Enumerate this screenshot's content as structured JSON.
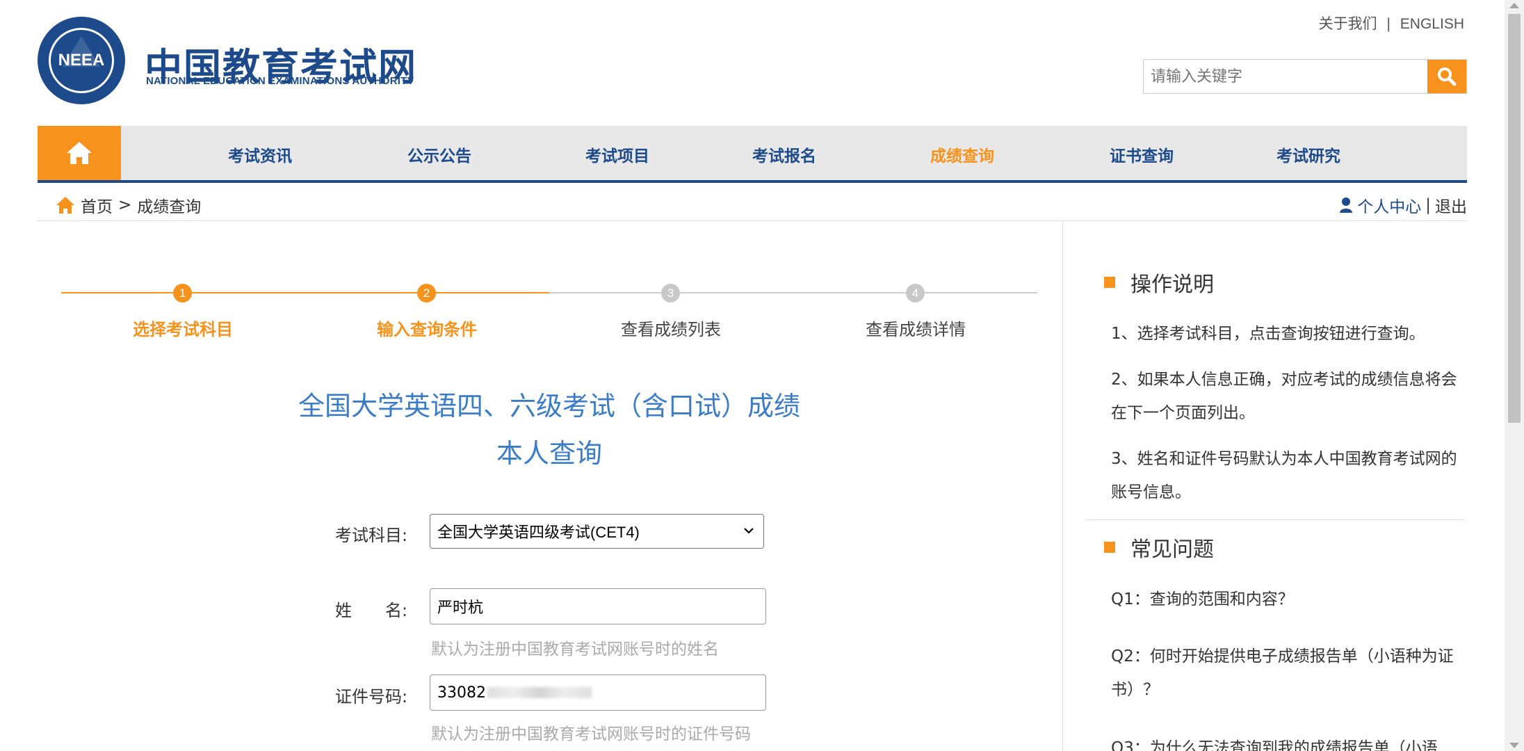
{
  "header": {
    "brand_cn": "中国教育考试网",
    "brand_en": "NATIONAL EDUCATION EXAMINATIONS AUTHORITY",
    "logo_text": "NEEA",
    "about": "关于我们",
    "separator": "|",
    "english": "ENGLISH",
    "search_placeholder": "请输入关键字"
  },
  "nav": {
    "items": [
      "考试资讯",
      "公示公告",
      "考试项目",
      "考试报名",
      "成绩查询",
      "证书查询",
      "考试研究"
    ],
    "active_index": 4
  },
  "breadcrumb": {
    "home": "首页",
    "sep": ">",
    "current": "成绩查询"
  },
  "user": {
    "center": "个人中心",
    "sep": "|",
    "logout": "退出"
  },
  "steps": [
    {
      "num": "1",
      "label": "选择考试科目",
      "done": true
    },
    {
      "num": "2",
      "label": "输入查询条件",
      "done": true
    },
    {
      "num": "3",
      "label": "查看成绩列表",
      "done": false
    },
    {
      "num": "4",
      "label": "查看成绩详情",
      "done": false
    }
  ],
  "title": {
    "line1": "全国大学英语四、六级考试（含口试）成绩",
    "line2": "本人查询"
  },
  "form": {
    "subject_label": "考试科目:",
    "subject_value": "全国大学英语四级考试(CET4)",
    "name_label": "姓　　名:",
    "name_value": "严时杭",
    "name_hint": "默认为注册中国教育考试网账号时的姓名",
    "id_label": "证件号码:",
    "id_value_visible": "33082",
    "id_hint": "默认为注册中国教育考试网账号时的证件号码"
  },
  "instructions": {
    "heading": "操作说明",
    "items": [
      "1、选择考试科目，点击查询按钮进行查询。",
      "2、如果本人信息正确，对应考试的成绩信息将会在下一个页面列出。",
      "3、姓名和证件号码默认为本人中国教育考试网的账号信息。"
    ]
  },
  "faq": {
    "heading": "常见问题",
    "items": [
      "Q1：查询的范围和内容？",
      "Q2：何时开始提供电子成绩报告单（小语种为证书）？",
      "Q3：为什么无法查询到我的成绩报告单（小语"
    ]
  },
  "colors": {
    "brand_blue": "#1c4a8a",
    "accent_orange": "#f7931d",
    "title_blue": "#3a7cc7"
  }
}
